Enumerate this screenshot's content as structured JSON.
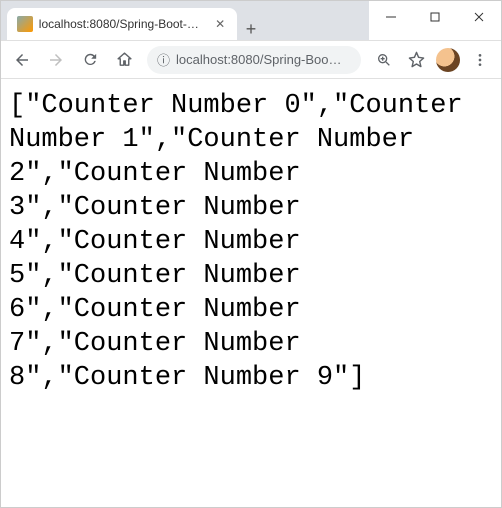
{
  "window": {
    "tab_title": "localhost:8080/Spring-Boot-Mav",
    "newtab_label": "+"
  },
  "address": {
    "info_icon": "ⓘ",
    "display_url": "localhost:8080/Spring-Boo…"
  },
  "body_text": "[\"Counter Number 0\",\"Counter Number 1\",\"Counter Number 2\",\"Counter Number 3\",\"Counter Number 4\",\"Counter Number 5\",\"Counter Number 6\",\"Counter Number 7\",\"Counter Number 8\",\"Counter Number 9\"]"
}
